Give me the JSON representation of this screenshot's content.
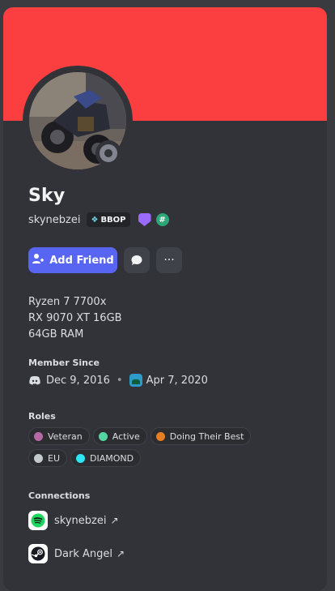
{
  "profile": {
    "display_name": "Sky",
    "username": "skynebzei",
    "tag": "BBOP",
    "bio": [
      "Ryzen 7 7700x",
      "RX 9070 XT 16GB",
      "64GB RAM"
    ],
    "colors": {
      "banner": "#fb3e40",
      "accent_button": "#5865f2",
      "card_bg": "#323339"
    }
  },
  "actions": {
    "add_friend_label": "Add Friend",
    "message_icon": "chat-bubble-icon",
    "more_icon": "ellipsis-icon"
  },
  "member_since": {
    "title": "Member Since",
    "discord_date": "Dec 9, 2016",
    "separator": "•",
    "server_date": "Apr 7, 2020"
  },
  "roles": {
    "title": "Roles",
    "items": [
      {
        "label": "Veteran",
        "color": "#b56aa5"
      },
      {
        "label": "Active",
        "color": "#57d3a1"
      },
      {
        "label": "Doing Their Best",
        "color": "#e67e22"
      },
      {
        "label": "EU",
        "color": "#c4c9ce"
      },
      {
        "label": "DIAMOND",
        "color": "#2ee4f7"
      }
    ]
  },
  "connections": {
    "title": "Connections",
    "items": [
      {
        "service": "spotify-icon",
        "name": "skynebzei",
        "arrow": "↗"
      },
      {
        "service": "steam-icon",
        "name": "Dark Angel",
        "arrow": "↗"
      }
    ]
  }
}
